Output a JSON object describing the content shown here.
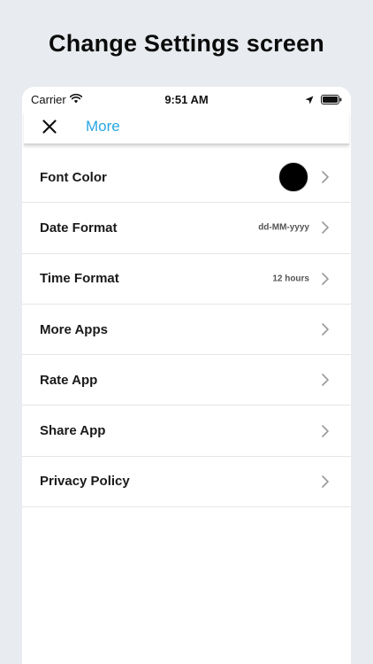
{
  "headline": "Change Settings screen",
  "status_bar": {
    "carrier": "Carrier",
    "time": "9:51 AM"
  },
  "nav": {
    "title": "More",
    "accent_color": "#2aa6e0"
  },
  "settings": [
    {
      "label": "Font Color",
      "value": "",
      "swatch_color": "#000000"
    },
    {
      "label": "Date Format",
      "value": "dd-MM-yyyy"
    },
    {
      "label": "Time Format",
      "value": "12 hours"
    },
    {
      "label": "More Apps",
      "value": ""
    },
    {
      "label": "Rate App",
      "value": ""
    },
    {
      "label": "Share App",
      "value": ""
    },
    {
      "label": "Privacy Policy",
      "value": ""
    }
  ]
}
